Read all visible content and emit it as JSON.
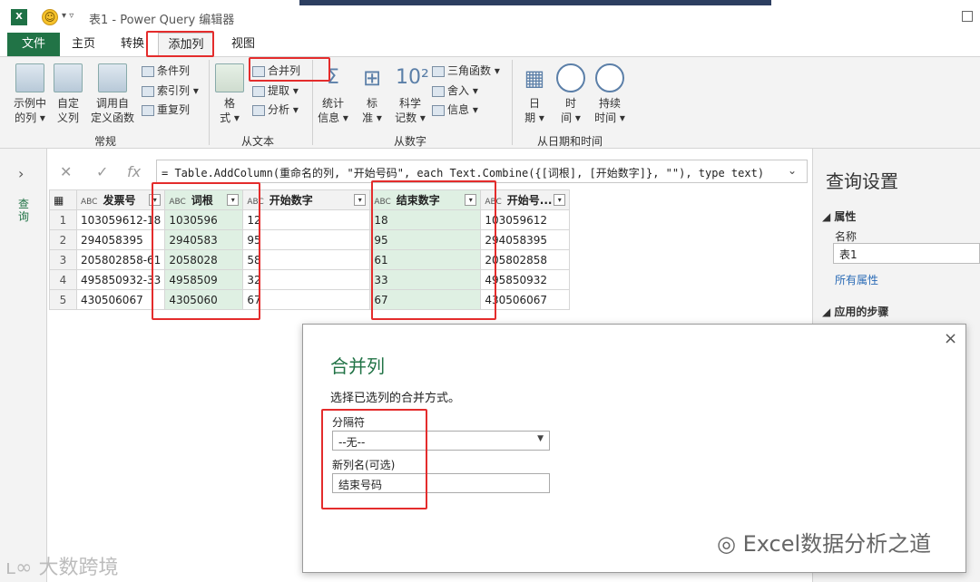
{
  "window": {
    "excel_icon": "X",
    "title": "表1 - Power Query 编辑器",
    "smiley_icon": "smiley-icon"
  },
  "tabs": [
    {
      "label": "文件"
    },
    {
      "label": "主页"
    },
    {
      "label": "转换"
    },
    {
      "label": "添加列"
    },
    {
      "label": "视图"
    }
  ],
  "ribbon": {
    "general": {
      "group_label": "常规",
      "example_col": {
        "line1": "示例中",
        "line2": "的列 ▾"
      },
      "custom_col": {
        "line1": "自定",
        "line2": "义列"
      },
      "invoke_fn": {
        "line1": "调用自",
        "line2": "定义函数"
      },
      "cond_col": "条件列",
      "index_col": "索引列 ▾",
      "dup_col": "重复列"
    },
    "from_text": {
      "group_label": "从文本",
      "format": {
        "line1": "格",
        "line2": "式 ▾"
      },
      "merge": "合并列",
      "extract": "提取 ▾",
      "parse": "分析 ▾"
    },
    "from_number": {
      "group_label": "从数字",
      "stats": {
        "line1": "统计",
        "line2": "信息 ▾"
      },
      "standard": {
        "line1": "标",
        "line2": "准 ▾"
      },
      "scientific": {
        "line1": "科学",
        "line2": "记数 ▾"
      },
      "trig": "三角函数 ▾",
      "round": "舍入 ▾",
      "info": "信息 ▾",
      "icon_10": "10²"
    },
    "from_datetime": {
      "group_label": "从日期和时间",
      "date": {
        "line1": "日",
        "line2": "期 ▾"
      },
      "time": {
        "line1": "时",
        "line2": "间 ▾"
      },
      "duration": {
        "line1": "持续",
        "line2": "时间 ▾"
      }
    }
  },
  "nav": {
    "label": "查询"
  },
  "formula": {
    "fx": "fx",
    "text": "= Table.AddColumn(重命名的列, \"开始号码\", each Text.Combine({[词根], [开始数字]}, \"\"), type text)"
  },
  "table": {
    "columns": [
      {
        "type": "ABC",
        "name": "发票号"
      },
      {
        "type": "ABC",
        "name": "词根"
      },
      {
        "type": "ABC",
        "name": "开始数字"
      },
      {
        "type": "ABC",
        "name": "结束数字"
      },
      {
        "type": "ABC",
        "name": "开始号..."
      }
    ],
    "rows": [
      {
        "n": "1",
        "c1": "103059612-18",
        "c2": "1030596",
        "c3": "12",
        "c4": "18",
        "c5": "103059612"
      },
      {
        "n": "2",
        "c1": "294058395",
        "c2": "2940583",
        "c3": "95",
        "c4": "95",
        "c5": "294058395"
      },
      {
        "n": "3",
        "c1": "205802858-61",
        "c2": "2058028",
        "c3": "58",
        "c4": "61",
        "c5": "205802858"
      },
      {
        "n": "4",
        "c1": "495850932-33",
        "c2": "4958509",
        "c3": "32",
        "c4": "33",
        "c5": "495850932"
      },
      {
        "n": "5",
        "c1": "430506067",
        "c2": "4305060",
        "c3": "67",
        "c4": "67",
        "c5": "430506067"
      }
    ]
  },
  "settings": {
    "title": "查询设置",
    "properties_header": "属性",
    "name_label": "名称",
    "name_value": "表1",
    "all_props": "所有属性",
    "steps_header": "应用的步骤"
  },
  "dialog": {
    "title": "合并列",
    "description": "选择已选列的合并方式。",
    "separator_label": "分隔符",
    "separator_value": "--无--",
    "newcol_label": "新列名(可选)",
    "newcol_value": "结束号码",
    "close": "×"
  },
  "watermark": {
    "right": "Excel数据分析之道",
    "left": "大数跨境"
  },
  "colors": {
    "accent": "#217346",
    "highlight": "#e42c2c",
    "selected_col": "#dff0e3"
  }
}
